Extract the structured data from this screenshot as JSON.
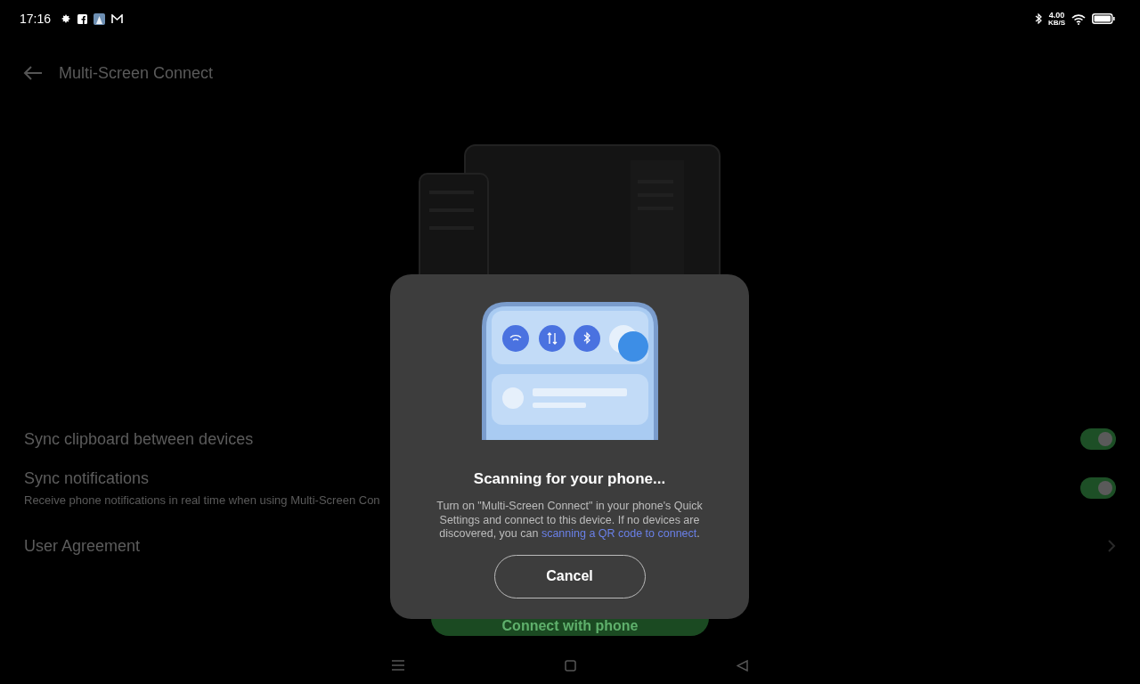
{
  "status_bar": {
    "time": "17:16",
    "speed": "4.00",
    "speed_unit": "KB/S"
  },
  "header": {
    "title": "Multi-Screen Connect"
  },
  "settings": [
    {
      "kind": "toggle",
      "label": "Sync clipboard between devices",
      "on": true
    },
    {
      "kind": "toggle",
      "label": "Sync notifications",
      "description": "Receive phone notifications in real time when using Multi-Screen Con",
      "on": true
    },
    {
      "kind": "link",
      "label": "User Agreement"
    }
  ],
  "connect_button": {
    "label": "Connect with phone"
  },
  "dialog": {
    "title": "Scanning for your phone...",
    "message": "Turn on \"Multi-Screen Connect\" in your phone's Quick Settings and connect to this device. If no devices are discovered, you can ",
    "link": "scanning a QR code to connect",
    "message_end": ".",
    "button": "Cancel"
  }
}
